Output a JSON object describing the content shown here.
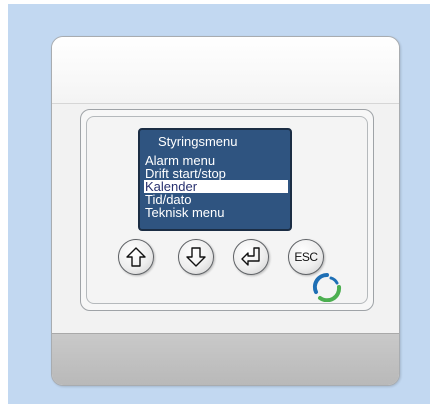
{
  "screen": {
    "title": "Styringsmenu",
    "items": [
      {
        "label": "Alarm menu",
        "selected": false
      },
      {
        "label": "Drift start/stop",
        "selected": false
      },
      {
        "label": "Kalender",
        "selected": true
      },
      {
        "label": "Tid/dato",
        "selected": false
      },
      {
        "label": "Teknisk menu",
        "selected": false
      }
    ]
  },
  "buttons": {
    "up_icon": "arrow-up-outline-icon",
    "down_icon": "arrow-down-outline-icon",
    "enter_icon": "enter-return-icon",
    "esc_label": "ESC"
  },
  "colors": {
    "background": "#c2d8f1",
    "lcd": "#2f5480",
    "lcd_text": "#ffffff",
    "selection_text": "#27306f",
    "logo_blue": "#1e6fb5",
    "logo_green": "#4caf50"
  }
}
